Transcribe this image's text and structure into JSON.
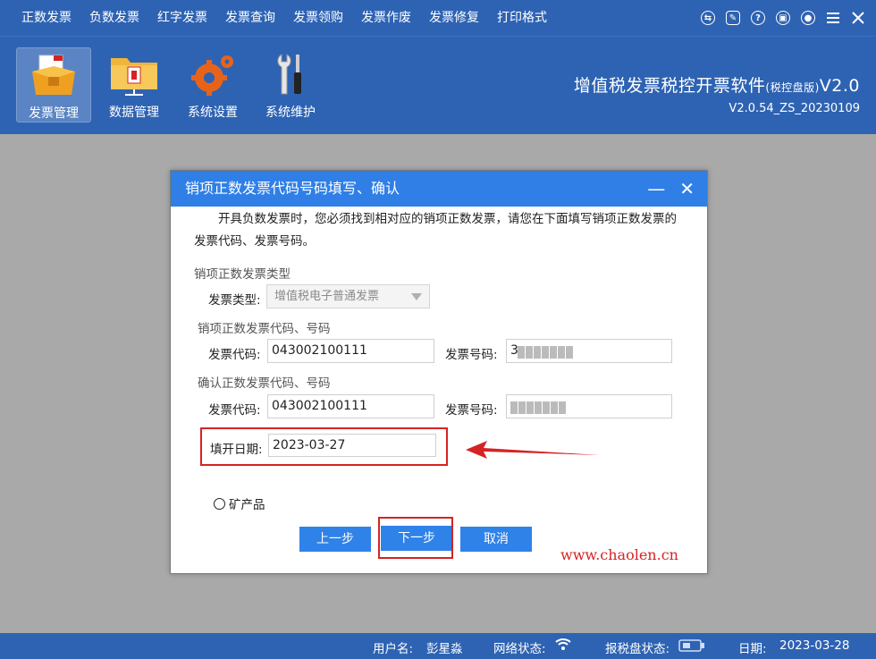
{
  "menu": {
    "items": [
      "正数发票",
      "负数发票",
      "红字发票",
      "发票查询",
      "发票领购",
      "发票作废",
      "发票修复",
      "打印格式"
    ],
    "window_icons": [
      "exchange-icon",
      "note-icon",
      "help-icon",
      "lock-icon",
      "user-icon",
      "menu-icon",
      "close-icon"
    ]
  },
  "toolbar": {
    "tools": [
      {
        "label": "发票管理",
        "icon": "invoice-box-icon",
        "active": true
      },
      {
        "label": "数据管理",
        "icon": "folder-data-icon",
        "active": false
      },
      {
        "label": "系统设置",
        "icon": "gear-icon",
        "active": false
      },
      {
        "label": "系统维护",
        "icon": "wrench-screwdriver-icon",
        "active": false
      }
    ],
    "brand_title": "增值税发票税控开票软件",
    "brand_edition": "(税控盘版)",
    "brand_suffix": "V2.0",
    "version": "V2.0.54_ZS_20230109"
  },
  "dialog": {
    "title": "销项正数发票代码号码填写、确认",
    "intro": "开具负数发票时，您必须找到相对应的销项正数发票，请您在下面填写销项正数发票的发票代码、发票号码。",
    "section_type": "销项正数发票类型",
    "type_label": "发票类型:",
    "type_value": "增值税电子普通发票",
    "section_code": "销项正数发票代码、号码",
    "code_label": "发票代码:",
    "code_value": "043002100111",
    "number_label": "发票号码:",
    "number_visible_prefix": "3",
    "section_confirm": "确认正数发票代码、号码",
    "confirm_code_label": "发票代码:",
    "confirm_code_value": "043002100111",
    "confirm_number_label": "发票号码:",
    "date_label": "填开日期:",
    "date_value": "2023-03-27",
    "radio_label": "矿产品",
    "prev_button": "上一步",
    "next_button": "下一步",
    "cancel_button": "取消"
  },
  "watermark": "www.chaolen.cn",
  "status": {
    "user_label": "用户名:",
    "user_value": "彭星淼",
    "network_label": "网络状态:",
    "disk_label": "报税盘状态:",
    "date_label": "日期:",
    "date_value": "2023-03-28"
  },
  "colors": {
    "chrome_blue": "#2e63b3",
    "dialog_title_blue": "#2f7fe6",
    "button_blue": "#2f82e8",
    "annotation_red": "#d52323"
  }
}
